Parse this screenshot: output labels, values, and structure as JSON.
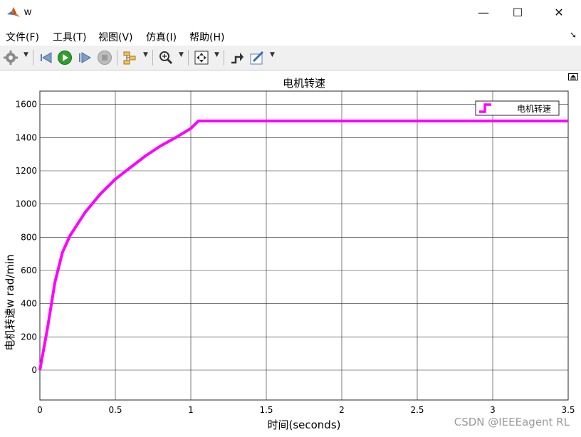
{
  "window": {
    "title": "w",
    "minimize_glyph": "—",
    "maximize_glyph": "☐",
    "close_glyph": "✕"
  },
  "menu": [
    {
      "label": "文件(F)"
    },
    {
      "label": "工具(T)"
    },
    {
      "label": "视图(V)"
    },
    {
      "label": "仿真(I)"
    },
    {
      "label": "帮助(H)"
    }
  ],
  "toolbar": {
    "icons": [
      "settings-icon",
      "step-back-icon",
      "run-icon",
      "step-forward-icon",
      "stop-icon",
      "signal-select-icon",
      "zoom-icon",
      "fit-to-view-icon",
      "trigger-icon",
      "style-icon"
    ]
  },
  "colors": {
    "line": "#ff00ff",
    "grid": "#262626",
    "run": "#2e9e2e"
  },
  "watermark": "CSDN @IEEEagent RL",
  "chart_data": {
    "type": "line",
    "title": "电机转速",
    "xlabel": "时间(seconds)",
    "ylabel": "电机转速w rad/min",
    "xlim": [
      0,
      3.5
    ],
    "ylim": [
      -180,
      1680
    ],
    "xticks": [
      0,
      0.5,
      1,
      1.5,
      2,
      2.5,
      3,
      3.5
    ],
    "xtick_labels": [
      "0",
      "0.5",
      "1",
      "1.5",
      "2",
      "2.5",
      "3",
      "3.5"
    ],
    "yticks": [
      0,
      200,
      400,
      600,
      800,
      1000,
      1200,
      1400,
      1600
    ],
    "ytick_labels": [
      "0",
      "200",
      "400",
      "600",
      "800",
      "1000",
      "1200",
      "1400",
      "1600"
    ],
    "grid": true,
    "legend_position": "top-right",
    "series": [
      {
        "name": "电机转速",
        "color": "#ff00ff",
        "x": [
          0,
          0.05,
          0.1,
          0.15,
          0.2,
          0.25,
          0.3,
          0.4,
          0.5,
          0.6,
          0.7,
          0.8,
          0.9,
          1.0,
          1.05,
          1.5,
          2.0,
          2.5,
          3.0,
          3.5
        ],
        "y": [
          0,
          250,
          530,
          710,
          810,
          880,
          950,
          1060,
          1150,
          1220,
          1290,
          1350,
          1400,
          1455,
          1500,
          1500,
          1500,
          1500,
          1500,
          1500
        ]
      }
    ]
  }
}
